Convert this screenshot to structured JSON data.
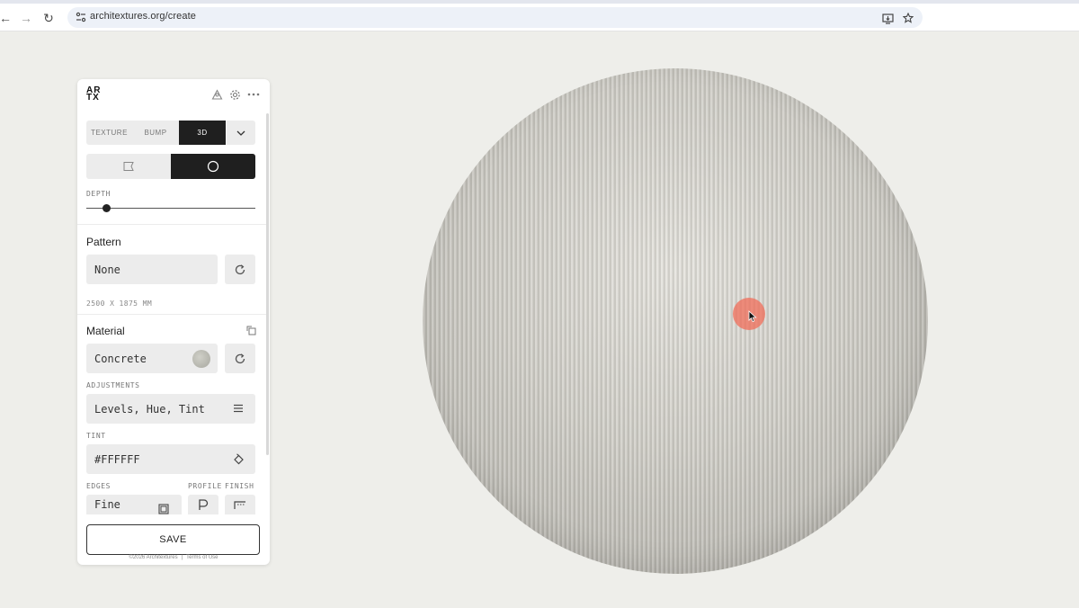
{
  "browser": {
    "url": "architextures.org/create",
    "back_glyph": "←",
    "forward_glyph": "→",
    "reload_glyph": "↻"
  },
  "panel": {
    "logo_line1": "AR",
    "logo_line2": "TX",
    "mode_tabs": [
      "TEXTURE",
      "BUMP",
      "3D"
    ],
    "active_mode": "3D",
    "depth_label": "DEPTH",
    "depth_value": 0.12,
    "pattern": {
      "title": "Pattern",
      "value": "None",
      "dimensions": "2500 X 1875 MM"
    },
    "material": {
      "title": "Material",
      "value": "Concrete",
      "adjustments_label": "ADJUSTMENTS",
      "adjustments_value": "Levels, Hue, Tint",
      "tint_label": "TINT",
      "tint_value": "#FFFFFF",
      "edges_label": "EDGES",
      "profile_label": "PROFILE",
      "finish_label": "FINISH",
      "edges_value": "Fine"
    },
    "save_label": "SAVE",
    "footer_copy": "©2026 Architextures",
    "footer_sep": "|",
    "footer_terms": "Terms of Use"
  },
  "colors": {
    "accent_dark": "#1f1f1f",
    "cursor_highlight": "#f06e5a"
  }
}
